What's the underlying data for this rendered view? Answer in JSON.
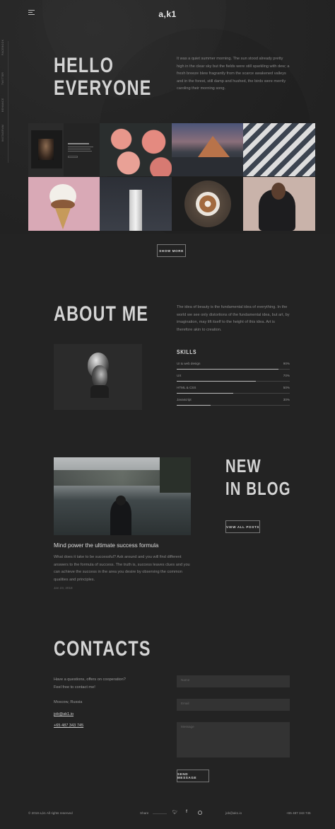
{
  "header": {
    "logo": "a,k1",
    "menu_icon": "hamburger-icon"
  },
  "social": [
    "FACEBOOK",
    "TWITTER",
    "BEHANCE",
    "INSTAGRAM"
  ],
  "hero": {
    "title_line1": "HELLO",
    "title_line2": "EVERYONE",
    "text": "It was a quiet summer morning. The sun stood already pretty high in the clear sky but the fields were still sparkling with dew; a fresh breeze blew fragrantly from the scarce awakened valleys and in the forest, still damp and hushed, the birds were merrily caroling their morning song."
  },
  "gallery": {
    "show_more": "SHOW MORE"
  },
  "about": {
    "title": "ABOUT ME",
    "text": "The idea of beauty is the fundamental idea of everything. In the world we see only distortions of the fundamental idea, but art, by imagination, may lift itself to the height of this idea. Art is therefore akin to creation.",
    "skills_title": "SKILLS",
    "skills": [
      {
        "label": "UI & web design",
        "value": "90%",
        "level": 0.9
      },
      {
        "label": "UX",
        "value": "70%",
        "level": 0.7
      },
      {
        "label": "HTML & CSS",
        "value": "50%",
        "level": 0.5
      },
      {
        "label": "Javascript",
        "value": "30%",
        "level": 0.3
      }
    ]
  },
  "blog": {
    "title_line1": "NEW",
    "title_line2": "IN BLOG",
    "view_all": "VIEW ALL POSTS",
    "post_title": "Mind power the ultimate success formula",
    "post_text": "What does it take to be successful? Ask around and you will find different answers to the formula of success. The truth is, success leaves clues and you can achieve the success in the area you desire by observing the common qualities and principles.",
    "post_date": "Jan 23, 2018"
  },
  "contacts": {
    "title": "CONTACTS",
    "intro_line1": "Have a questions, offers on cooperation?",
    "intro_line2": "Feel free to contact me!",
    "location": "Moscow, Russia",
    "email": "job@ak1.io",
    "phone": "+65 487 343 745",
    "name_placeholder": "Name",
    "email_placeholder": "Email",
    "message_placeholder": "Message",
    "send": "SEND MESSAGE"
  },
  "footer": {
    "copyright": "© 2018 a,k1 All rights reserved",
    "share": "Share",
    "email": "job@ak1.io",
    "phone": "+65 487 343 745"
  }
}
